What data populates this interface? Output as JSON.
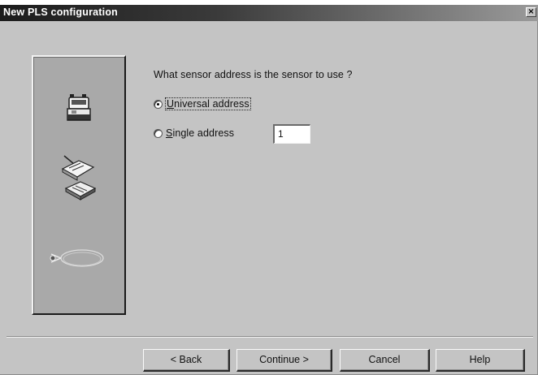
{
  "window": {
    "title": "New PLS configuration",
    "close_glyph": "×"
  },
  "side_panel": {
    "icons": [
      "sensor-scanner-icon",
      "configuration-papers-icon",
      "cable-icon"
    ]
  },
  "main": {
    "prompt": "What sensor address is the sensor to use ?",
    "options": [
      {
        "mnemonic": "U",
        "rest": "niversal address",
        "selected": true
      },
      {
        "mnemonic": "S",
        "rest": "ingle address",
        "selected": false
      }
    ],
    "single_address_value": "1"
  },
  "buttons": {
    "back": "< Back",
    "continue": "Continue >",
    "cancel": "Cancel",
    "help": "Help"
  }
}
